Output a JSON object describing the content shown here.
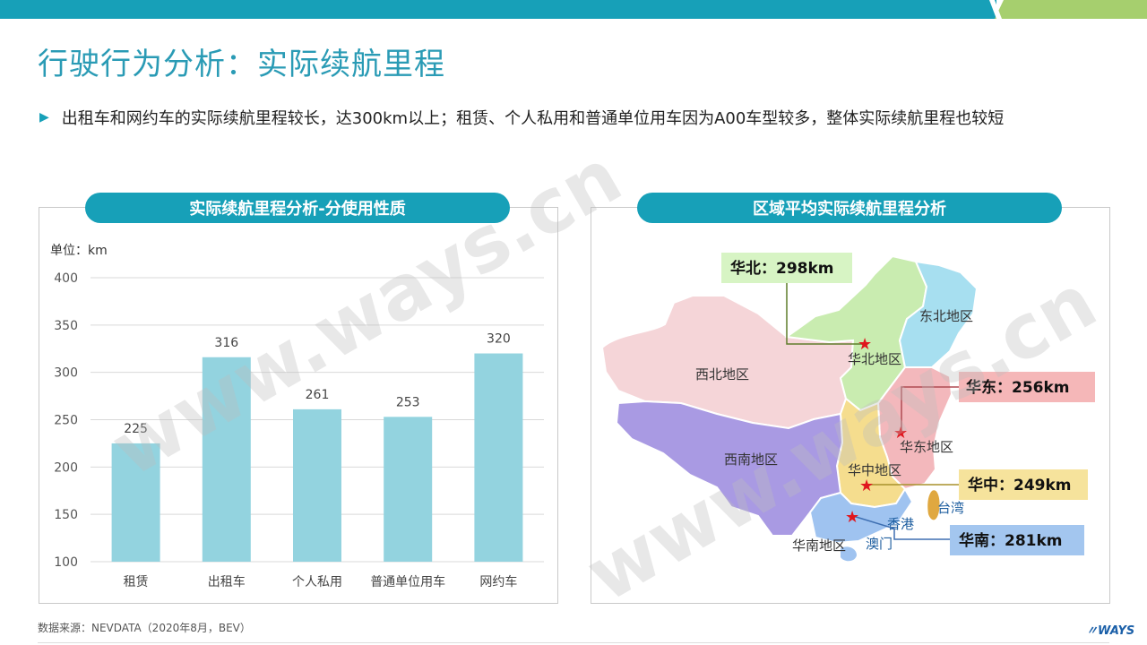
{
  "page_title": "行驶行为分析：实际续航里程",
  "bullet_text": "出租车和网约车的实际续航里程较长，达300km以上；租赁、个人私用和普通单位用车因为A00车型较多，整体实际续航里程也较短",
  "left_panel": {
    "title": "实际续航里程分析-分使用性质",
    "unit_label": "单位：km"
  },
  "right_panel": {
    "title": "区域平均实际续航里程分析"
  },
  "chart_data": {
    "type": "bar",
    "categories": [
      "租赁",
      "出租车",
      "个人私用",
      "普通单位用车",
      "网约车"
    ],
    "values": [
      225,
      316,
      261,
      253,
      320
    ],
    "ylim": [
      100,
      400
    ],
    "yticks": [
      100,
      150,
      200,
      250,
      300,
      350,
      400
    ],
    "grid": true,
    "bar_color": "#93d3df"
  },
  "map": {
    "regions": [
      {
        "name": "西北地区",
        "color": "#f5d5d8"
      },
      {
        "name": "华北地区",
        "color": "#c9ecb0"
      },
      {
        "name": "东北地区",
        "color": "#a7dff0"
      },
      {
        "name": "华东地区",
        "color": "#f3b8bc"
      },
      {
        "name": "华中地区",
        "color": "#f5dd8e"
      },
      {
        "name": "西南地区",
        "color": "#a99ae3"
      },
      {
        "name": "华南地区",
        "color": "#9fc3f0"
      }
    ],
    "extra_labels": {
      "taiwan": "台湾",
      "hongkong": "香港",
      "macau": "澳门"
    },
    "callouts": [
      {
        "text": "华北：298km",
        "bg": "#d7f4c4"
      },
      {
        "text": "华东：256km",
        "bg": "#f5b7b8"
      },
      {
        "text": "华中：249km",
        "bg": "#f6e39c"
      },
      {
        "text": "华南：281km",
        "bg": "#a3c6ef"
      }
    ]
  },
  "source_text": "数据来源：NEVDATA（2020年8月，BEV）",
  "logo_text": "WAYS",
  "watermark_text": "www.ways.cn"
}
